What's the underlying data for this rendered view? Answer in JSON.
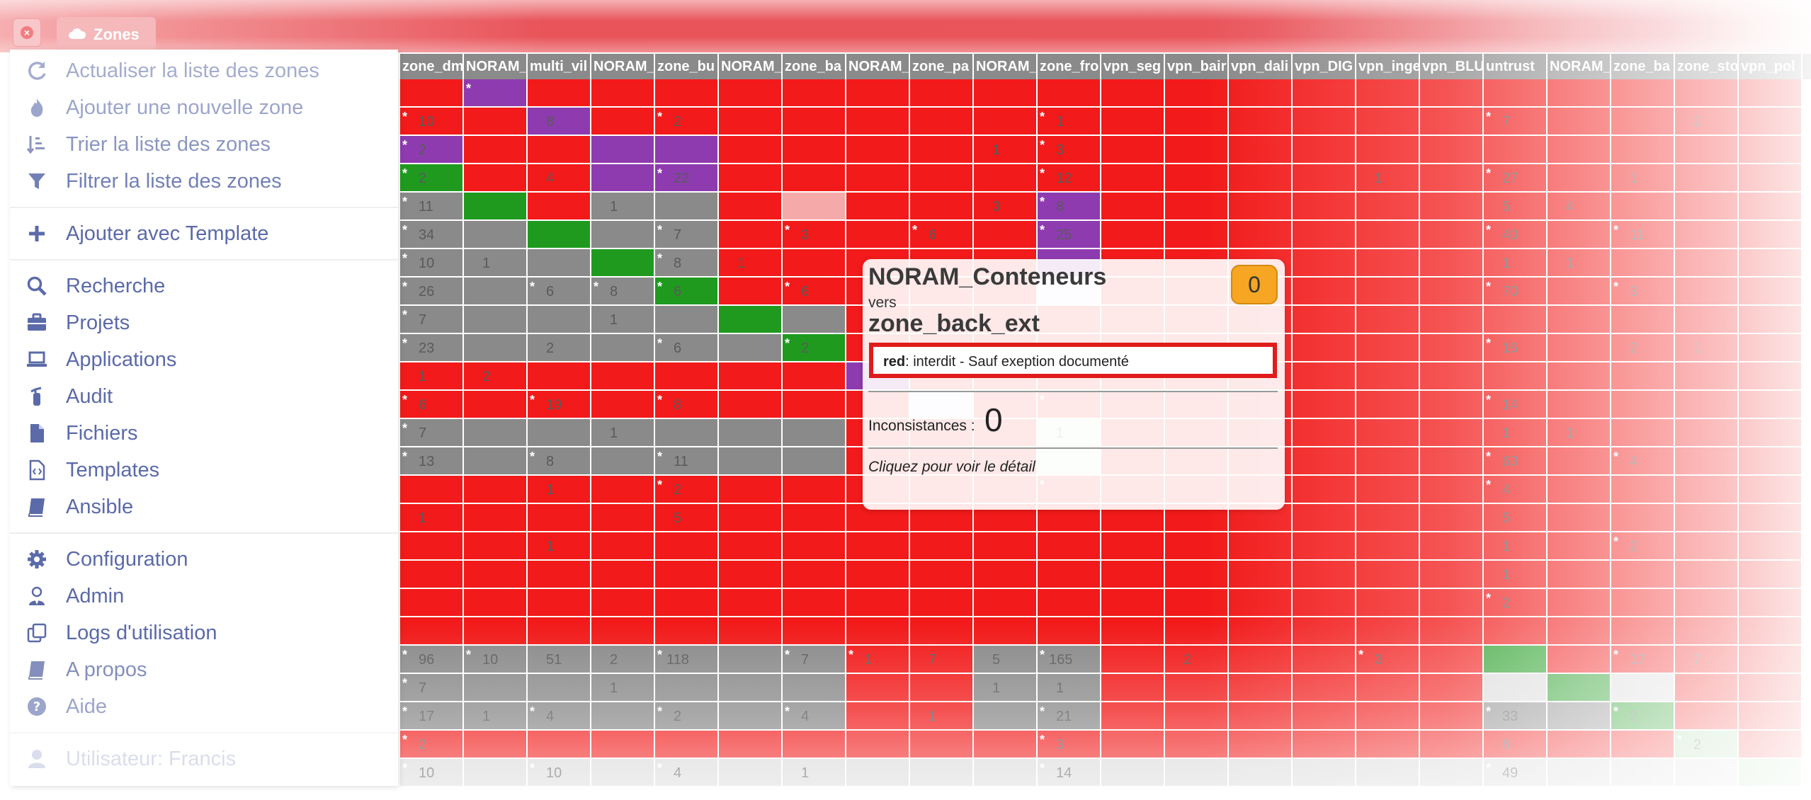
{
  "tabs": {
    "active_label": "Zones",
    "close_icon": "close-circle-icon"
  },
  "menu": {
    "items": [
      {
        "label": "Actualiser la liste des zones",
        "icon": "refresh-icon"
      },
      {
        "label": "Ajouter une nouvelle zone",
        "icon": "fire-icon"
      },
      {
        "label": "Trier la liste des zones",
        "icon": "sort-icon"
      },
      {
        "label": "Filtrer la liste des zones",
        "icon": "filter-icon"
      },
      {
        "label": "Ajouter avec Template",
        "icon": "plus-icon"
      },
      {
        "label": "Recherche",
        "icon": "search-icon"
      },
      {
        "label": "Projets",
        "icon": "briefcase-icon"
      },
      {
        "label": "Applications",
        "icon": "laptop-icon"
      },
      {
        "label": "Audit",
        "icon": "fire-extinguisher-icon"
      },
      {
        "label": "Fichiers",
        "icon": "file-icon"
      },
      {
        "label": "Templates",
        "icon": "file-code-icon"
      },
      {
        "label": "Ansible",
        "icon": "book-icon"
      },
      {
        "label": "Configuration",
        "icon": "gear-icon"
      },
      {
        "label": "Admin",
        "icon": "user-tie-icon"
      },
      {
        "label": "Logs d'utilisation",
        "icon": "clone-icon"
      },
      {
        "label": "A propos",
        "icon": "book-icon"
      },
      {
        "label": "Aide",
        "icon": "question-circle-icon"
      },
      {
        "label": "Utilisateur: Francis",
        "icon": "user-icon"
      }
    ]
  },
  "matrix": {
    "columns": [
      "zone_dm",
      "NORAM_",
      "multi_vil",
      "NORAM_",
      "zone_bu",
      "NORAM_",
      "zone_ba",
      "NORAM_",
      "zone_pa",
      "NORAM_",
      "zone_fro",
      "vpn_seg",
      "vpn_bair",
      "vpn_dali",
      "vpn_DIG",
      "vpn_inge",
      "vpn_BLU",
      "untrust",
      "NORAM_",
      "zone_ba",
      "zone_sto",
      "vpn_pol"
    ],
    "rows": [
      [
        "r",
        "p*",
        "r",
        "r",
        "r",
        "r",
        "r",
        "r",
        "r",
        "r",
        "r",
        "r",
        "r",
        "r",
        "r",
        "r",
        "r",
        "r",
        "r",
        "r",
        "r",
        "r"
      ],
      [
        "r*10",
        "r",
        "p8",
        "r",
        "r*2",
        "r",
        "r",
        "r",
        "r",
        "r",
        "r*1",
        "r",
        "r",
        "r",
        "r",
        "r",
        "r",
        "r*7",
        "r",
        "r",
        "r2",
        "r"
      ],
      [
        "p*2",
        "r",
        "r",
        "p",
        "p",
        "r",
        "r",
        "r",
        "r",
        "r1",
        "r*3",
        "r",
        "r",
        "r",
        "r",
        "r",
        "r",
        "r",
        "r",
        "r",
        "r",
        "r"
      ],
      [
        "g*2",
        "r",
        "r4",
        "p",
        "p*22",
        "r",
        "r",
        "r",
        "r",
        "r",
        "r*12",
        "r",
        "r",
        "r",
        "r",
        "r1",
        "r",
        "r*27",
        "r",
        "r1",
        "r",
        "r"
      ],
      [
        "k*11",
        "g",
        "r",
        "k1",
        "k",
        "r",
        "pk",
        "r",
        "r",
        "r3",
        "p*8",
        "r",
        "r",
        "r",
        "r",
        "r",
        "r",
        "r5",
        "r4",
        "r",
        "r",
        "r"
      ],
      [
        "k*34",
        "k",
        "g",
        "k",
        "k*7",
        "r",
        "r*3",
        "r",
        "r*6",
        "r",
        "p*25",
        "r",
        "r",
        "r",
        "r",
        "r",
        "r",
        "r*40",
        "r",
        "r*11",
        "r",
        "r"
      ],
      [
        "k*10",
        "k1",
        "k",
        "g",
        "k*8",
        "r1",
        "r",
        "r",
        "r",
        "r",
        "p",
        "r",
        "r",
        "r",
        "r",
        "r",
        "r",
        "r1",
        "r1",
        "r",
        "r",
        "r"
      ],
      [
        "k*26",
        "k",
        "k*6",
        "k*8",
        "g*6",
        "r",
        "r*6",
        "r",
        "r",
        "r",
        "vi",
        "r",
        "r",
        "r",
        "r",
        "r",
        "r",
        "r*70",
        "r",
        "r*3",
        "r",
        "r"
      ],
      [
        "k*7",
        "k",
        "k",
        "k1",
        "k",
        "g",
        "k",
        "r",
        "r",
        "r",
        "r",
        "r",
        "r",
        "r",
        "r",
        "r",
        "r",
        "r",
        "r",
        "r",
        "r",
        "r"
      ],
      [
        "k*23",
        "k",
        "k2",
        "k",
        "k*6",
        "k",
        "g*2",
        "r",
        "r",
        "r",
        "r",
        "r",
        "r",
        "r",
        "r",
        "r",
        "r",
        "r*16",
        "r",
        "r2",
        "r1",
        "r"
      ],
      [
        "r1",
        "r2",
        "r",
        "r",
        "r",
        "r",
        "r",
        "p",
        "r",
        "r",
        "r",
        "r",
        "r",
        "r",
        "r",
        "r",
        "r",
        "r",
        "r",
        "r",
        "r",
        "r"
      ],
      [
        "r*6",
        "r",
        "r*19",
        "r",
        "r*8",
        "r",
        "r",
        "r",
        "vi",
        "r",
        "r*",
        "r",
        "r",
        "r",
        "r",
        "r",
        "r",
        "r*14",
        "r",
        "r",
        "r",
        "r"
      ],
      [
        "k*7",
        "k",
        "k",
        "k1",
        "k",
        "k",
        "k",
        "r",
        "r",
        "r",
        "mi1",
        "r",
        "r",
        "r",
        "r",
        "r",
        "r",
        "r1",
        "r1",
        "r",
        "r",
        "r"
      ],
      [
        "k*13",
        "k",
        "k*8",
        "k",
        "k*11",
        "k",
        "k",
        "r",
        "r",
        "r",
        "mi",
        "r",
        "r",
        "r",
        "r",
        "r",
        "r",
        "r*63",
        "r",
        "r*4",
        "r",
        "r"
      ],
      [
        "r",
        "r",
        "r1",
        "r",
        "r*2",
        "r",
        "r",
        "r",
        "r",
        "r",
        "r*",
        "r",
        "r",
        "r",
        "r",
        "r",
        "r",
        "r*4",
        "r",
        "r",
        "r",
        "r"
      ],
      [
        "r1",
        "r",
        "r",
        "r",
        "r5",
        "r",
        "r",
        "r",
        "r",
        "r",
        "r",
        "r",
        "r",
        "r",
        "r",
        "r",
        "r",
        "r5",
        "r",
        "r",
        "r",
        "r"
      ],
      [
        "r",
        "r",
        "r1",
        "r",
        "r",
        "r",
        "r",
        "r",
        "r",
        "r",
        "r",
        "r",
        "r",
        "r",
        "r",
        "r",
        "r",
        "r1",
        "r",
        "r*2",
        "r",
        "r"
      ],
      [
        "r",
        "r",
        "r",
        "r",
        "r",
        "r",
        "r",
        "r",
        "r",
        "r",
        "r",
        "r",
        "r",
        "r",
        "r",
        "r",
        "r",
        "r1",
        "r",
        "r",
        "r",
        "r"
      ],
      [
        "r",
        "r",
        "r",
        "r",
        "r",
        "r",
        "r",
        "r",
        "r",
        "r",
        "r",
        "r",
        "r",
        "r",
        "r",
        "r",
        "r",
        "r*2",
        "r",
        "r",
        "r",
        "r"
      ],
      [
        "r",
        "r",
        "r",
        "r",
        "r",
        "r",
        "r",
        "r",
        "r",
        "r",
        "r",
        "r",
        "r",
        "r",
        "r",
        "r",
        "r",
        "r",
        "r",
        "r",
        "r",
        "r"
      ],
      [
        "k*96",
        "k*10",
        "k51",
        "k2",
        "k*118",
        "k",
        "k*7",
        "r*1",
        "r7",
        "k5",
        "k*165",
        "r",
        "r2",
        "r",
        "r",
        "r*3",
        "r",
        "g",
        "r",
        "r*17",
        "r7",
        "r"
      ],
      [
        "k*7",
        "k",
        "k",
        "k1",
        "k",
        "k",
        "k",
        "r",
        "r",
        "k1",
        "k1",
        "r",
        "r",
        "r",
        "r",
        "r",
        "r",
        "l",
        "g",
        "l",
        "r",
        "r"
      ],
      [
        "k*17",
        "k1",
        "k*4",
        "k",
        "k*2",
        "k",
        "k*4",
        "r",
        "r1",
        "k",
        "k*21",
        "r",
        "r",
        "r",
        "r",
        "r",
        "r",
        "k*33",
        "k",
        "g*2",
        "r",
        "r"
      ],
      [
        "r*2",
        "r",
        "r",
        "r",
        "r",
        "r",
        "r",
        "r",
        "r",
        "r",
        "r*3",
        "r",
        "r",
        "r",
        "r",
        "r",
        "r",
        "r8",
        "r",
        "r",
        "lg*2",
        "r"
      ],
      [
        "l*10",
        "l",
        "l*10",
        "l",
        "l*4",
        "l",
        "l1",
        "l",
        "l",
        "l",
        "l*14",
        "l",
        "l",
        "l",
        "l",
        "l",
        "l",
        "l*49",
        "l",
        "l",
        "l",
        "lg"
      ]
    ]
  },
  "tooltip": {
    "from_zone": "NORAM_Conteneurs",
    "vers": "vers",
    "to_zone": "zone_back_ext",
    "badge": "0",
    "rule_color": "red",
    "rule_text": ": interdit - Sauf exeption documenté",
    "inconsistances_label": "Inconsistances :",
    "inconsistances_value": "0",
    "hint": "Cliquez pour voir le détail"
  },
  "colors": {
    "forbidden": "#f21a1a",
    "same_zone": "#8a8a8a",
    "allowed": "#1f9a1f",
    "special": "#8e3bb0",
    "menu_text": "#5b6aa9",
    "badge": "#f6a623"
  }
}
